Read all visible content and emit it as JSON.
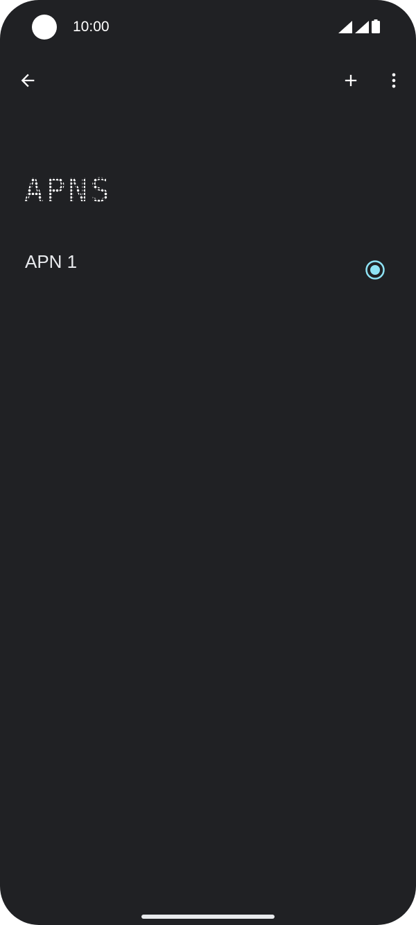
{
  "status_bar": {
    "time": "10:00",
    "icons": [
      "camera-cutout",
      "signal-icon",
      "signal-icon",
      "battery-icon"
    ]
  },
  "toolbar": {
    "back_icon": "arrow-left-icon",
    "add_icon": "plus-icon",
    "more_icon": "more-vert-icon"
  },
  "page": {
    "title": "APNS"
  },
  "apn_list": [
    {
      "name": "APN 1",
      "selected": true
    }
  ],
  "colors": {
    "background": "#202124",
    "text": "#ffffff",
    "accent": "#8ee3f5"
  }
}
